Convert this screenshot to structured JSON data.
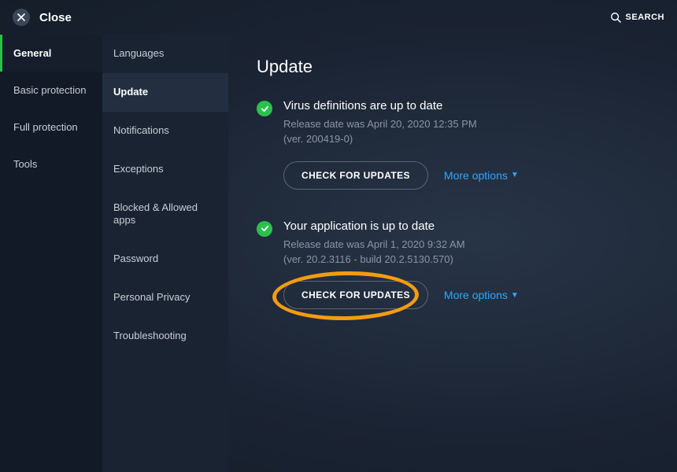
{
  "topbar": {
    "close_label": "Close",
    "search_label": "SEARCH"
  },
  "sidebar_primary": {
    "items": [
      {
        "label": "General",
        "active": true
      },
      {
        "label": "Basic protection",
        "active": false
      },
      {
        "label": "Full protection",
        "active": false
      },
      {
        "label": "Tools",
        "active": false
      }
    ]
  },
  "sidebar_secondary": {
    "items": [
      {
        "label": "Languages",
        "active": false
      },
      {
        "label": "Update",
        "active": true
      },
      {
        "label": "Notifications",
        "active": false
      },
      {
        "label": "Exceptions",
        "active": false
      },
      {
        "label": "Blocked & Allowed apps",
        "active": false
      },
      {
        "label": "Password",
        "active": false
      },
      {
        "label": "Personal Privacy",
        "active": false
      },
      {
        "label": "Troubleshooting",
        "active": false
      }
    ]
  },
  "content": {
    "page_title": "Update",
    "virus": {
      "status": "Virus definitions are up to date",
      "release": "Release date was April 20, 2020 12:35 PM",
      "version": "(ver. 200419-0)",
      "check_label": "CHECK FOR UPDATES",
      "more_label": "More options"
    },
    "app": {
      "status": "Your application is up to date",
      "release": "Release date was April 1, 2020 9:32 AM",
      "version": "(ver. 20.2.3116 - build 20.2.5130.570)",
      "check_label": "CHECK FOR UPDATES",
      "more_label": "More options"
    }
  }
}
